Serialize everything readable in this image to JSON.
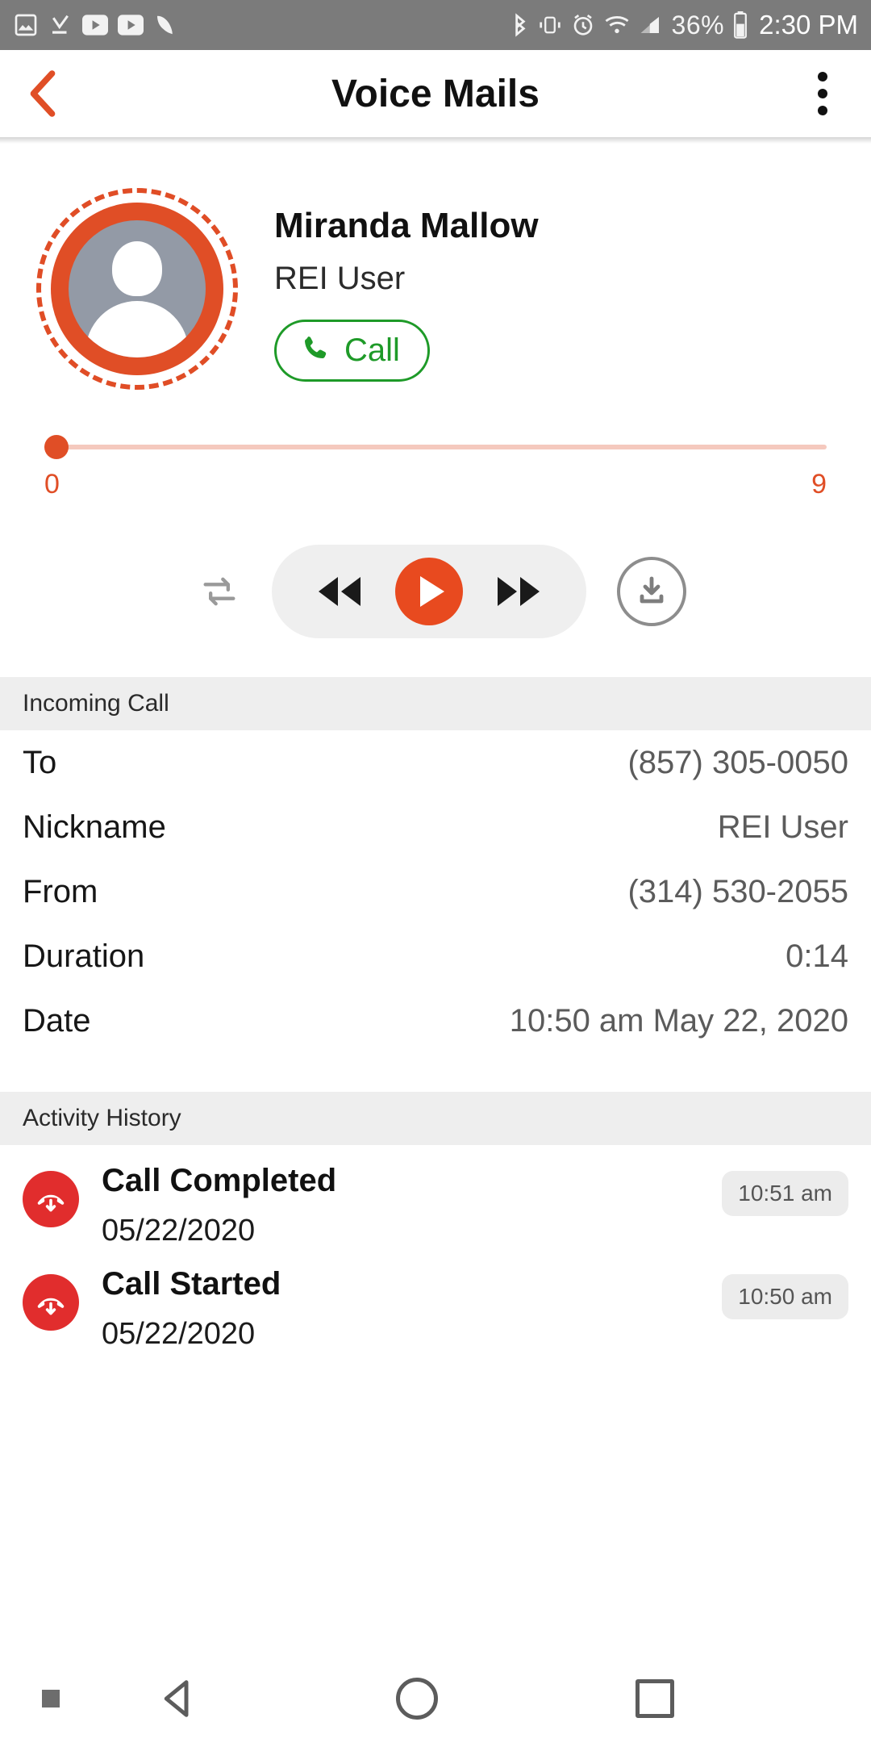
{
  "status_bar": {
    "notif_icons": [
      "image-icon",
      "download-done-icon",
      "video-play-icon",
      "video-play-icon-2",
      "tag-icon"
    ],
    "system_icons": [
      "bluetooth-icon",
      "vibrate-icon",
      "alarm-icon",
      "wifi-icon",
      "signal-icon"
    ],
    "battery_percent": "36%",
    "time": "2:30 PM"
  },
  "appbar": {
    "title": "Voice Mails",
    "back_icon": "back-chevron-icon",
    "overflow_icon": "overflow-menu-icon"
  },
  "contact": {
    "name": "Miranda Mallow",
    "subtitle": "REI User",
    "avatar_icon": "person-avatar-icon",
    "call_button": {
      "label": "Call",
      "icon": "phone-icon",
      "color": "#1e9a28"
    }
  },
  "player": {
    "position_label": "0",
    "duration_label": "9",
    "progress_percent": 0,
    "repeat_icon": "repeat-icon",
    "rewind_icon": "rewind-icon",
    "play_icon": "play-icon",
    "forward_icon": "fast-forward-icon",
    "download_icon": "download-icon",
    "accent_color": "#e84a1f",
    "track_color": "#f5c9be"
  },
  "details": {
    "section_title": "Incoming Call",
    "rows": [
      {
        "label": "To",
        "value": "(857) 305-0050"
      },
      {
        "label": "Nickname",
        "value": "REI User"
      },
      {
        "label": "From",
        "value": "(314) 530-2055"
      },
      {
        "label": "Duration",
        "value": "0:14"
      },
      {
        "label": "Date",
        "value": "10:50 am May 22, 2020"
      }
    ]
  },
  "activity": {
    "section_title": "Activity History",
    "items": [
      {
        "title": "Call Completed",
        "date": "05/22/2020",
        "time": "10:51 am",
        "icon": "call-incoming-icon"
      },
      {
        "title": "Call Started",
        "date": "05/22/2020",
        "time": "10:50 am",
        "icon": "call-incoming-icon"
      }
    ]
  },
  "navbar": {
    "back_icon": "nav-back-icon",
    "home_icon": "nav-home-icon",
    "recents_icon": "nav-recents-icon"
  }
}
